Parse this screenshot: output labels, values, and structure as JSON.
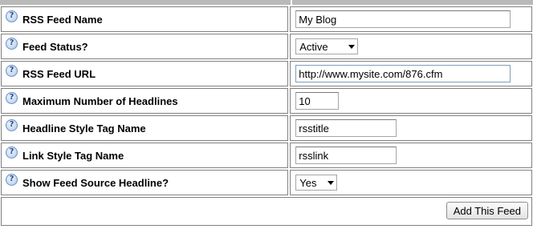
{
  "help_glyph": "?",
  "fields": [
    {
      "label": "RSS Feed Name",
      "type": "text",
      "value": "My Blog",
      "width": "long"
    },
    {
      "label": "Feed Status?",
      "type": "select",
      "value": "Active"
    },
    {
      "label": "RSS Feed URL",
      "type": "text",
      "value": "http://www.mysite.com/876.cfm",
      "width": "long",
      "focused": true
    },
    {
      "label": "Maximum Number of Headlines",
      "type": "text",
      "value": "10",
      "width": "short"
    },
    {
      "label": "Headline Style Tag Name",
      "type": "text",
      "value": "rsstitle",
      "width": "medium"
    },
    {
      "label": "Link Style Tag Name",
      "type": "text",
      "value": "rsslink",
      "width": "medium"
    },
    {
      "label": "Show Feed Source Headline?",
      "type": "select",
      "value": "Yes"
    }
  ],
  "submit_label": "Add This Feed"
}
